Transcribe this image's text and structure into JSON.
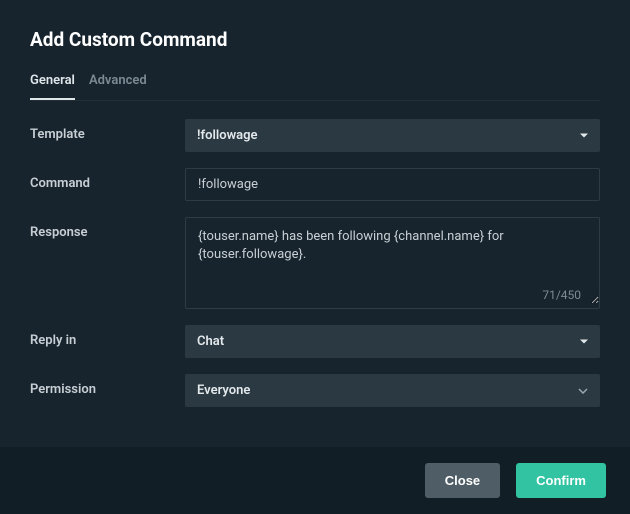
{
  "title": "Add Custom Command",
  "tabs": {
    "general": "General",
    "advanced": "Advanced"
  },
  "labels": {
    "template": "Template",
    "command": "Command",
    "response": "Response",
    "reply_in": "Reply in",
    "permission": "Permission"
  },
  "fields": {
    "template": "!followage",
    "command": "!followage",
    "response": "{touser.name} has been following {channel.name} for {touser.followage}.",
    "char_count": "71/450",
    "reply_in": "Chat",
    "permission": "Everyone"
  },
  "buttons": {
    "close": "Close",
    "confirm": "Confirm"
  }
}
